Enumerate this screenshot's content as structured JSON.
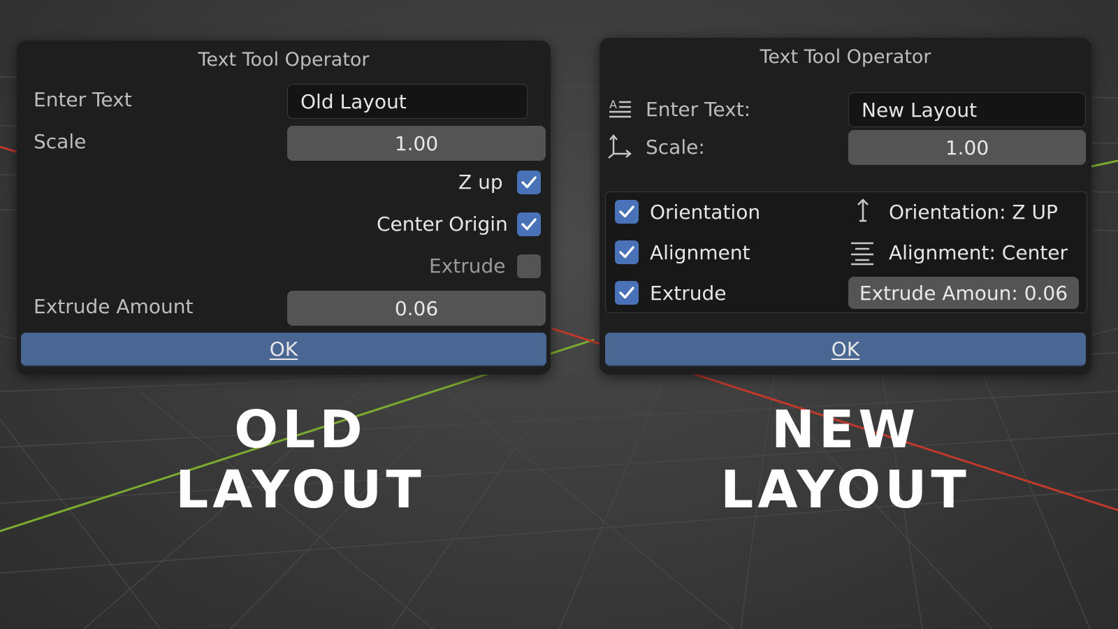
{
  "colors": {
    "background": "#3a3a3a",
    "dialog_bg": "#1e1e1e",
    "accent_checkbox": "#4a72b8",
    "ok_button": "#4a6794",
    "number_field": "#545454",
    "axis_x_red": "#c0392b",
    "axis_y_green": "#7cab2f"
  },
  "old": {
    "title": "Text Tool Operator",
    "enter_text_label": "Enter Text",
    "enter_text_value": "Old Layout",
    "scale_label": "Scale",
    "scale_value": "1.00",
    "z_up_label": "Z up",
    "z_up_checked": true,
    "center_origin_label": "Center Origin",
    "center_origin_checked": true,
    "extrude_label": "Extrude",
    "extrude_checked": false,
    "extrude_amount_label": "Extrude Amount",
    "extrude_amount_value": "0.06",
    "ok_label": "OK",
    "caption": "OLD LAYOUT"
  },
  "new": {
    "title": "Text Tool Operator",
    "enter_text_label": "Enter Text:",
    "enter_text_value": "New Layout",
    "scale_label": "Scale:",
    "scale_value": "1.00",
    "orientation_label": "Orientation",
    "orientation_checked": true,
    "orientation_value": "Orientation: Z UP",
    "alignment_label": "Alignment",
    "alignment_checked": true,
    "alignment_value": "Alignment: Center",
    "extrude_label": "Extrude",
    "extrude_checked": true,
    "extrude_amount_value": "Extrude Amoun: 0.06",
    "ok_label": "OK",
    "caption": "NEW LAYOUT"
  },
  "icons": {
    "text_field": "text-lines-icon",
    "scale": "axes-icon",
    "orientation": "arrow-up-icon",
    "alignment": "align-center-icon",
    "check": "checkmark-icon"
  }
}
